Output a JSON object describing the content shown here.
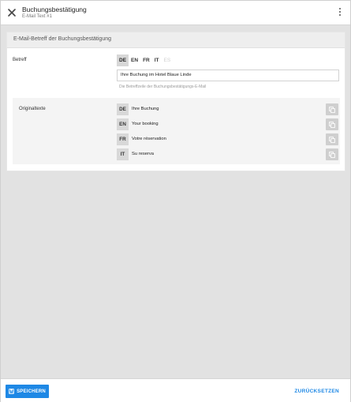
{
  "header": {
    "title": "Buchungsbestätigung",
    "subtitle": "E-Mail Text  #1"
  },
  "card": {
    "title": "E-Mail-Betreff der Buchungsbestätigung",
    "betreff_label": "Betreff",
    "languages": [
      {
        "code": "DE",
        "state": "active"
      },
      {
        "code": "EN",
        "state": "normal"
      },
      {
        "code": "FR",
        "state": "normal"
      },
      {
        "code": "IT",
        "state": "normal"
      },
      {
        "code": "ES",
        "state": "disabled"
      }
    ],
    "subject_value": "Ihre Buchung im Hotel Blaue Linde",
    "subject_hint": "Die Betreffzeile der Buchungsbestätigungs-E-Mail",
    "originals_label": "Originaltexte",
    "originals": [
      {
        "code": "DE",
        "text": "Ihre Buchung"
      },
      {
        "code": "EN",
        "text": "Your booking"
      },
      {
        "code": "FR",
        "text": "Votre réservation"
      },
      {
        "code": "IT",
        "text": "Su reserva"
      }
    ]
  },
  "footer": {
    "save_label": "SPEICHERN",
    "reset_label": "ZURÜCKSETZEN"
  },
  "colors": {
    "accent": "#1e88e5",
    "background": "#e2e2e2"
  },
  "icons": {
    "close": "close-icon",
    "menu": "more-vertical-icon",
    "save": "save-icon",
    "copy": "copy-icon"
  }
}
